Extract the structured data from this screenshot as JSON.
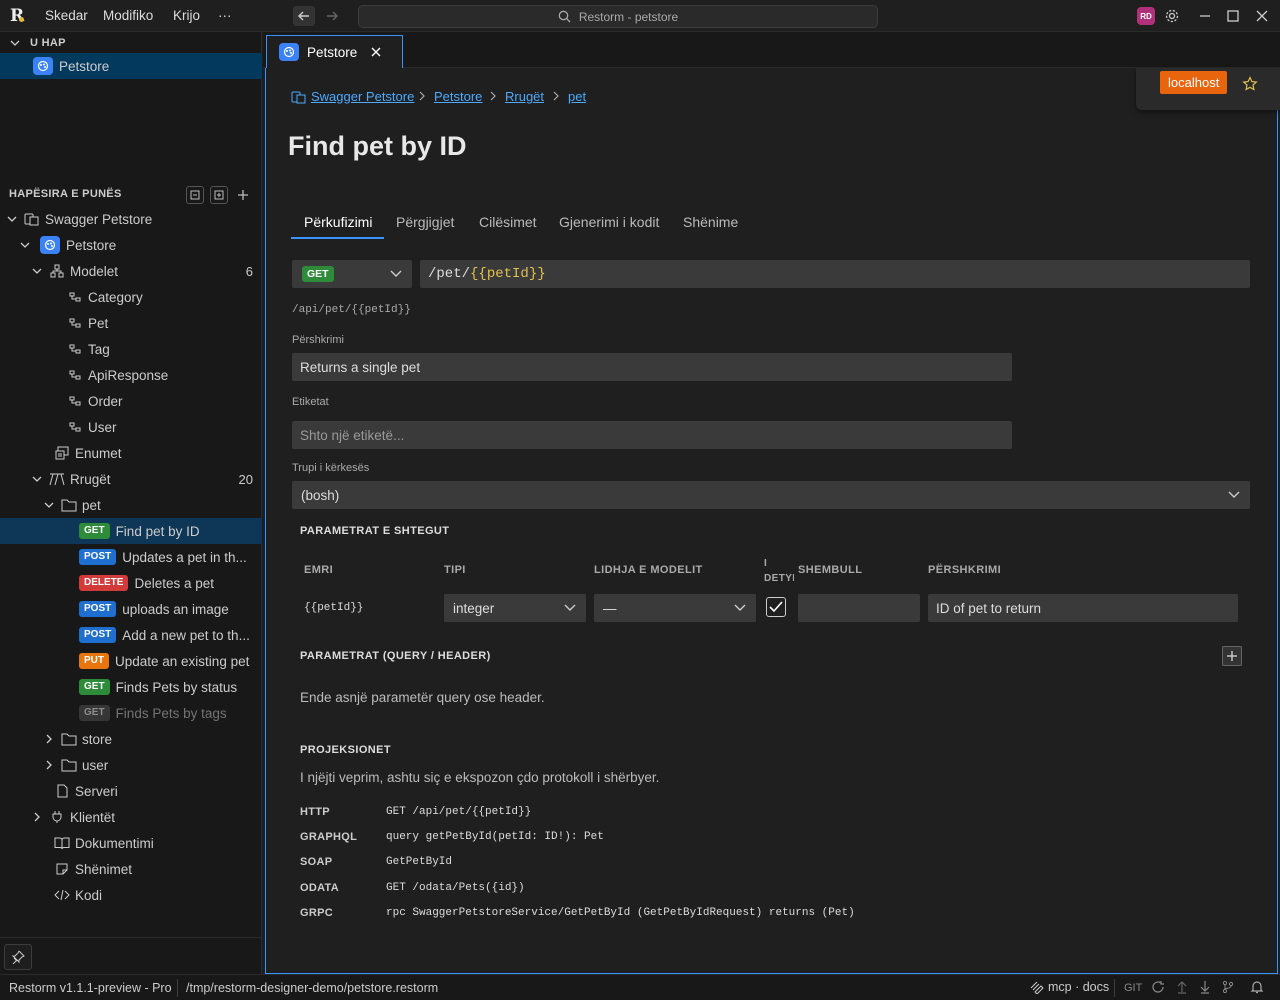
{
  "titlebar": {
    "menu": [
      "Skedar",
      "Modifiko",
      "Krijo",
      "···"
    ],
    "search": "Restorm - petstore",
    "avatar": "RD"
  },
  "sidebar": {
    "open_header": "U HAP",
    "open_item": "Petstore",
    "workspace_header": "HAPËSIRA E PUNËS",
    "tree": {
      "root": "Swagger Petstore",
      "api": "Petstore",
      "models": {
        "label": "Modelet",
        "count": "6",
        "items": [
          "Category",
          "Pet",
          "Tag",
          "ApiResponse",
          "Order",
          "User"
        ]
      },
      "enums": "Enumet",
      "routes": {
        "label": "Rrugët",
        "count": "20"
      },
      "pet_folder": "pet",
      "endpoints": [
        {
          "method": "GET",
          "label": "Find pet by ID"
        },
        {
          "method": "POST",
          "label": "Updates a pet in th..."
        },
        {
          "method": "DELETE",
          "label": "Deletes a pet"
        },
        {
          "method": "POST",
          "label": "uploads an image"
        },
        {
          "method": "POST",
          "label": "Add a new pet to th..."
        },
        {
          "method": "PUT",
          "label": "Update an existing pet"
        },
        {
          "method": "GET",
          "label": "Finds Pets by status"
        },
        {
          "method": "GET",
          "label": "Finds Pets by tags"
        }
      ],
      "store_folder": "store",
      "user_folder": "user",
      "servers": "Serveri",
      "clients": "Klientët",
      "docs": "Dokumentimi",
      "notes": "Shënimet",
      "code": "Kodi"
    }
  },
  "tab": {
    "label": "Petstore"
  },
  "server": {
    "label": "localhost"
  },
  "breadcrumb": [
    "Swagger Petstore",
    "Petstore",
    "Rrugët",
    "pet"
  ],
  "page_title": "Find pet by ID",
  "editor_tabs": [
    "Përkufizimi",
    "Përgjigjet",
    "Cilësimet",
    "Gjenerimi i kodit",
    "Shënime"
  ],
  "request": {
    "method": "GET",
    "url_prefix": "/pet/",
    "url_param": "{{petId}}",
    "resolved_path": "/api/pet/{{petId}}"
  },
  "description": {
    "label": "Përshkrimi",
    "value": "Returns a single pet"
  },
  "tags": {
    "label": "Etiketat",
    "placeholder": "Shto një etiketë..."
  },
  "body": {
    "label": "Trupi i kërkesës",
    "value": "(bosh)"
  },
  "path_params": {
    "title": "PARAMETRAT E SHTEGUT",
    "columns": [
      "EMRI",
      "TIPI",
      "LIDHJA E MODELIT",
      "I DETYRUESHËM",
      "SHEMBULL",
      "PËRSHKRIMI"
    ],
    "rows": [
      {
        "name": "{{petId}}",
        "type": "integer",
        "model": "—",
        "required": true,
        "example": "",
        "description": "ID of pet to return"
      }
    ]
  },
  "query_params": {
    "title": "PARAMETRAT (QUERY / HEADER)",
    "empty": "Ende asnjë parametër query ose header."
  },
  "projections": {
    "title": "PROJEKSIONET",
    "subtitle": "I njëjti veprim, ashtu siç e ekspozon çdo protokoll i shërbyer.",
    "items": [
      {
        "proto": "HTTP",
        "value": "GET /api/pet/{{petId}}"
      },
      {
        "proto": "GRAPHQL",
        "value": "query getPetById(petId: ID!): Pet"
      },
      {
        "proto": "SOAP",
        "value": "GetPetById"
      },
      {
        "proto": "ODATA",
        "value": "GET /odata/Pets({id})"
      },
      {
        "proto": "GRPC",
        "value": "rpc SwaggerPetstoreService/GetPetById (GetPetByIdRequest) returns (Pet)"
      }
    ]
  },
  "statusbar": {
    "version": "Restorm v1.1.1-preview - Pro",
    "path": "/tmp/restorm-designer-demo/petstore.restorm",
    "mcp": "mcp · docs",
    "git": "GIT"
  }
}
